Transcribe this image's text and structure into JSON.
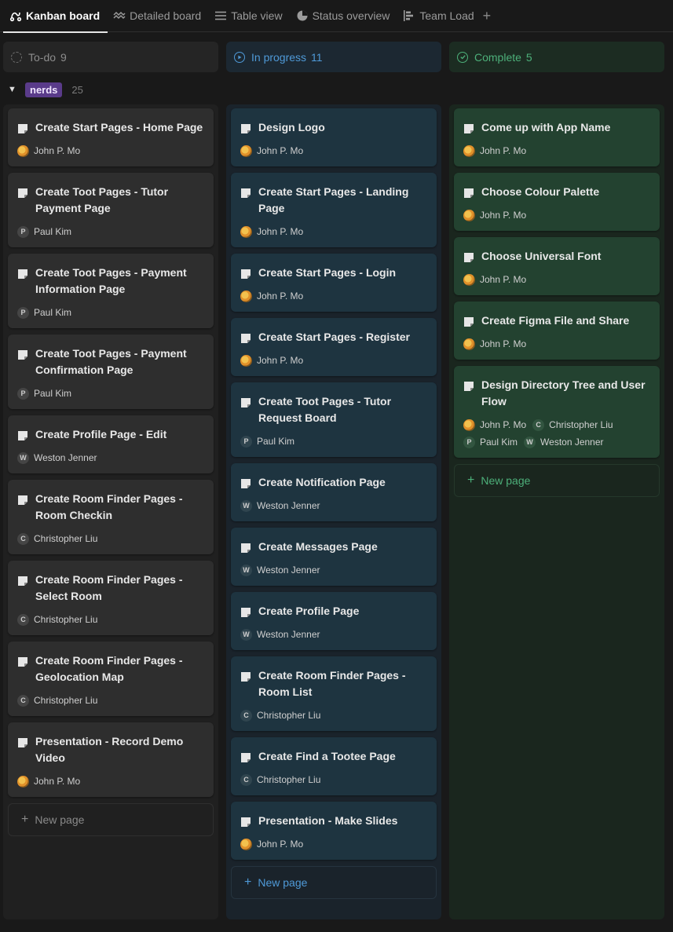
{
  "tabs": [
    {
      "label": "Kanban board",
      "icon": "kanban-icon",
      "active": true
    },
    {
      "label": "Detailed board",
      "icon": "wave-icon",
      "active": false
    },
    {
      "label": "Table view",
      "icon": "table-icon",
      "active": false
    },
    {
      "label": "Status overview",
      "icon": "pie-icon",
      "active": false
    },
    {
      "label": "Team Load",
      "icon": "timeline-icon",
      "active": false
    }
  ],
  "add_view": "+",
  "group": {
    "label": "nerds",
    "count": "25",
    "caret": "▼"
  },
  "columns": [
    {
      "label": "To-do",
      "count": "9",
      "color": "#8c8c8c",
      "new_page": "New page",
      "cards": [
        {
          "title": "Create Start Pages -  Home Page",
          "assignees": [
            {
              "name": "John P. Mo",
              "avatar": "emoji"
            }
          ]
        },
        {
          "title": "Create Toot Pages - Tutor Payment Page",
          "assignees": [
            {
              "name": "Paul Kim",
              "avatar": "P"
            }
          ]
        },
        {
          "title": "Create Toot Pages - Payment Information Page",
          "assignees": [
            {
              "name": "Paul Kim",
              "avatar": "P"
            }
          ]
        },
        {
          "title": "Create Toot Pages - Payment Confirmation Page",
          "assignees": [
            {
              "name": "Paul Kim",
              "avatar": "P"
            }
          ]
        },
        {
          "title": "Create Profile Page - Edit",
          "assignees": [
            {
              "name": "Weston Jenner",
              "avatar": "W"
            }
          ]
        },
        {
          "title": "Create Room Finder Pages - Room Checkin",
          "assignees": [
            {
              "name": "Christopher Liu",
              "avatar": "C"
            }
          ]
        },
        {
          "title": "Create Room Finder Pages - Select Room",
          "assignees": [
            {
              "name": "Christopher Liu",
              "avatar": "C"
            }
          ]
        },
        {
          "title": "Create Room Finder Pages - Geolocation Map",
          "assignees": [
            {
              "name": "Christopher Liu",
              "avatar": "C"
            }
          ]
        },
        {
          "title": "Presentation - Record Demo Video",
          "assignees": [
            {
              "name": "John P. Mo",
              "avatar": "emoji"
            }
          ]
        }
      ]
    },
    {
      "label": "In progress",
      "count": "11",
      "color": "#4f9ad8",
      "new_page": "New page",
      "cards": [
        {
          "title": "Design Logo",
          "assignees": [
            {
              "name": "John P. Mo",
              "avatar": "emoji"
            }
          ]
        },
        {
          "title": "Create Start Pages -  Landing Page",
          "assignees": [
            {
              "name": "John P. Mo",
              "avatar": "emoji"
            }
          ]
        },
        {
          "title": "Create Start Pages -  Login",
          "assignees": [
            {
              "name": "John P. Mo",
              "avatar": "emoji"
            }
          ]
        },
        {
          "title": "Create Start Pages -  Register",
          "assignees": [
            {
              "name": "John P. Mo",
              "avatar": "emoji"
            }
          ]
        },
        {
          "title": "Create Toot Pages - Tutor Request Board",
          "assignees": [
            {
              "name": "Paul Kim",
              "avatar": "P"
            }
          ]
        },
        {
          "title": "Create Notification Page",
          "assignees": [
            {
              "name": "Weston Jenner",
              "avatar": "W"
            }
          ]
        },
        {
          "title": "Create Messages Page",
          "assignees": [
            {
              "name": "Weston Jenner",
              "avatar": "W"
            }
          ]
        },
        {
          "title": "Create Profile Page",
          "assignees": [
            {
              "name": "Weston Jenner",
              "avatar": "W"
            }
          ]
        },
        {
          "title": "Create Room Finder Pages - Room List",
          "assignees": [
            {
              "name": "Christopher Liu",
              "avatar": "C"
            }
          ]
        },
        {
          "title": "Create Find a Tootee Page",
          "assignees": [
            {
              "name": "Christopher Liu",
              "avatar": "C"
            }
          ]
        },
        {
          "title": "Presentation - Make Slides",
          "assignees": [
            {
              "name": "John P. Mo",
              "avatar": "emoji"
            }
          ]
        }
      ]
    },
    {
      "label": "Complete",
      "count": "5",
      "color": "#4db07a",
      "new_page": "New page",
      "cards": [
        {
          "title": "Come up with App Name",
          "assignees": [
            {
              "name": "John P. Mo",
              "avatar": "emoji"
            }
          ]
        },
        {
          "title": "Choose Colour Palette",
          "assignees": [
            {
              "name": "John P. Mo",
              "avatar": "emoji"
            }
          ]
        },
        {
          "title": "Choose Universal Font",
          "assignees": [
            {
              "name": "John P. Mo",
              "avatar": "emoji"
            }
          ]
        },
        {
          "title": "Create Figma File and Share",
          "assignees": [
            {
              "name": "John P. Mo",
              "avatar": "emoji"
            }
          ]
        },
        {
          "title": "Design Directory Tree and User Flow",
          "assignees": [
            {
              "name": "John P. Mo",
              "avatar": "emoji"
            },
            {
              "name": "Christopher Liu",
              "avatar": "C"
            },
            {
              "name": "Paul Kim",
              "avatar": "P"
            },
            {
              "name": "Weston Jenner",
              "avatar": "W"
            }
          ]
        }
      ]
    }
  ]
}
